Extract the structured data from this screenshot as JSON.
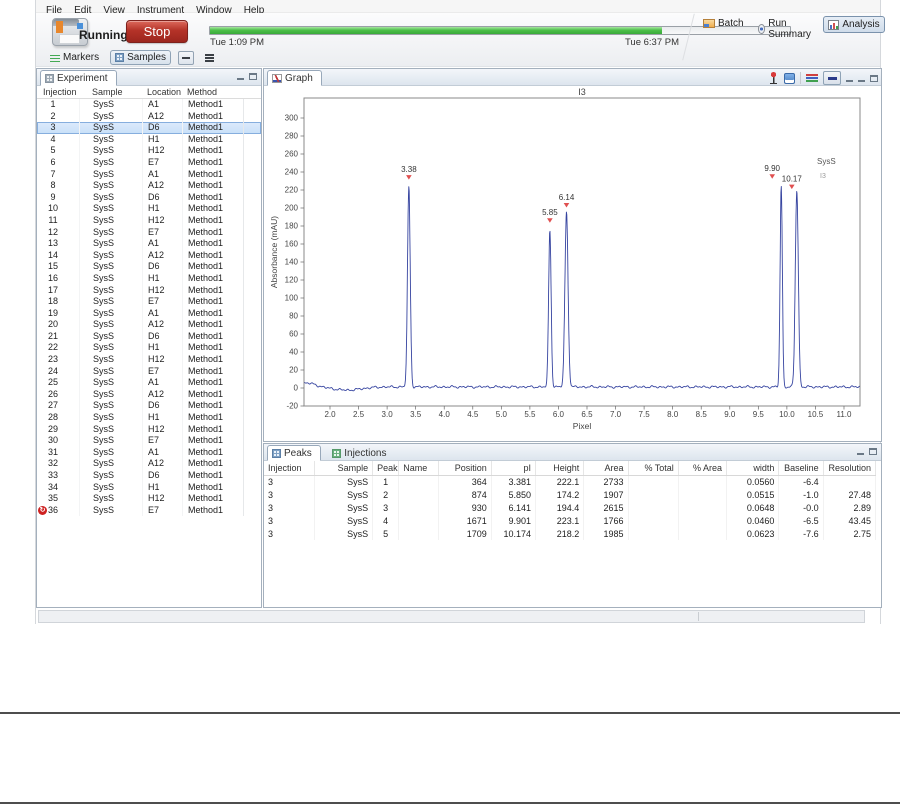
{
  "menu": {
    "items": [
      "File",
      "Edit",
      "View",
      "Instrument",
      "Window",
      "Help"
    ]
  },
  "toolbar": {
    "status": "Running",
    "stop_label": "Stop",
    "progress": {
      "start_label": "Tue 1:09 PM",
      "end_label": "Tue 6:37 PM",
      "fraction": 0.78
    },
    "buttons": [
      {
        "label": "Batch",
        "active": false
      },
      {
        "label": "Run Summary",
        "active": false
      },
      {
        "label": "Analysis",
        "active": true
      }
    ],
    "view_tabs": [
      {
        "label": "Markers",
        "active": false
      },
      {
        "label": "Samples",
        "active": true
      }
    ]
  },
  "experiment": {
    "title": "Experiment",
    "columns": [
      "Injection",
      "Sample",
      "Location",
      "Method"
    ],
    "selected_injection": 3,
    "flagged_injection": 36,
    "rows": [
      [
        1,
        "SysS",
        "A1",
        "Method1"
      ],
      [
        2,
        "SysS",
        "A12",
        "Method1"
      ],
      [
        3,
        "SysS",
        "D6",
        "Method1"
      ],
      [
        4,
        "SysS",
        "H1",
        "Method1"
      ],
      [
        5,
        "SysS",
        "H12",
        "Method1"
      ],
      [
        6,
        "SysS",
        "E7",
        "Method1"
      ],
      [
        7,
        "SysS",
        "A1",
        "Method1"
      ],
      [
        8,
        "SysS",
        "A12",
        "Method1"
      ],
      [
        9,
        "SysS",
        "D6",
        "Method1"
      ],
      [
        10,
        "SysS",
        "H1",
        "Method1"
      ],
      [
        11,
        "SysS",
        "H12",
        "Method1"
      ],
      [
        12,
        "SysS",
        "E7",
        "Method1"
      ],
      [
        13,
        "SysS",
        "A1",
        "Method1"
      ],
      [
        14,
        "SysS",
        "A12",
        "Method1"
      ],
      [
        15,
        "SysS",
        "D6",
        "Method1"
      ],
      [
        16,
        "SysS",
        "H1",
        "Method1"
      ],
      [
        17,
        "SysS",
        "H12",
        "Method1"
      ],
      [
        18,
        "SysS",
        "E7",
        "Method1"
      ],
      [
        19,
        "SysS",
        "A1",
        "Method1"
      ],
      [
        20,
        "SysS",
        "A12",
        "Method1"
      ],
      [
        21,
        "SysS",
        "D6",
        "Method1"
      ],
      [
        22,
        "SysS",
        "H1",
        "Method1"
      ],
      [
        23,
        "SysS",
        "H12",
        "Method1"
      ],
      [
        24,
        "SysS",
        "E7",
        "Method1"
      ],
      [
        25,
        "SysS",
        "A1",
        "Method1"
      ],
      [
        26,
        "SysS",
        "A12",
        "Method1"
      ],
      [
        27,
        "SysS",
        "D6",
        "Method1"
      ],
      [
        28,
        "SysS",
        "H1",
        "Method1"
      ],
      [
        29,
        "SysS",
        "H12",
        "Method1"
      ],
      [
        30,
        "SysS",
        "E7",
        "Method1"
      ],
      [
        31,
        "SysS",
        "A1",
        "Method1"
      ],
      [
        32,
        "SysS",
        "A12",
        "Method1"
      ],
      [
        33,
        "SysS",
        "D6",
        "Method1"
      ],
      [
        34,
        "SysS",
        "H1",
        "Method1"
      ],
      [
        35,
        "SysS",
        "H12",
        "Method1"
      ],
      [
        36,
        "SysS",
        "E7",
        "Method1"
      ]
    ]
  },
  "graph": {
    "tab_label": "Graph"
  },
  "chart_data": {
    "type": "line",
    "title": "I3",
    "xlabel": "Pixel",
    "ylabel": "Absorbance (mAU)",
    "xlim": [
      1.55,
      11.28
    ],
    "ylim": [
      -20,
      322
    ],
    "xticks": [
      2.0,
      2.5,
      3.0,
      3.5,
      4.0,
      4.5,
      5.0,
      5.5,
      6.0,
      6.5,
      7.0,
      7.5,
      8.0,
      8.5,
      9.0,
      9.5,
      10.0,
      10.5,
      11.0
    ],
    "yticks": [
      -20,
      0,
      20,
      40,
      60,
      80,
      100,
      120,
      140,
      160,
      180,
      200,
      220,
      240,
      260,
      280,
      300
    ],
    "legend": {
      "name": "SysS",
      "injection": "I3",
      "position": "top-right"
    },
    "grid": false,
    "baseline": 0,
    "peaks": [
      {
        "pi": 3.381,
        "height": 222.1,
        "width": 0.056,
        "label": "3.38",
        "label_dx": 0,
        "label_dy": 0
      },
      {
        "pi": 5.85,
        "height": 174.2,
        "width": 0.0515,
        "label": "5.85",
        "label_dx": 0,
        "label_dy": 0
      },
      {
        "pi": 6.141,
        "height": 194.4,
        "width": 0.0648,
        "label": "6.14",
        "label_dx": 0,
        "label_dy": 3
      },
      {
        "pi": 9.901,
        "height": 223.1,
        "width": 0.046,
        "label": "9.90",
        "label_dx": -9,
        "label_dy": 0
      },
      {
        "pi": 10.174,
        "height": 218.2,
        "width": 0.0623,
        "label": "10.17",
        "label_dx": -5,
        "label_dy": 6
      }
    ]
  },
  "peaks_panel": {
    "tabs": [
      "Peaks",
      "Injections"
    ],
    "active_tab": "Peaks",
    "columns": [
      "Injection",
      "Sample",
      "Peak",
      "Name",
      "Position",
      "pI",
      "Height",
      "Area",
      "% Total",
      "% Area",
      "width",
      "Baseline",
      "Resolution"
    ],
    "rows": [
      [
        "3",
        "SysS",
        "1",
        "",
        "364",
        "3.381",
        "222.1",
        "2733",
        "",
        "",
        "0.0560",
        "-6.4",
        ""
      ],
      [
        "3",
        "SysS",
        "2",
        "",
        "874",
        "5.850",
        "174.2",
        "1907",
        "",
        "",
        "0.0515",
        "-1.0",
        "27.48"
      ],
      [
        "3",
        "SysS",
        "3",
        "",
        "930",
        "6.141",
        "194.4",
        "2615",
        "",
        "",
        "0.0648",
        "-0.0",
        "2.89"
      ],
      [
        "3",
        "SysS",
        "4",
        "",
        "1671",
        "9.901",
        "223.1",
        "1766",
        "",
        "",
        "0.0460",
        "-6.5",
        "43.45"
      ],
      [
        "3",
        "SysS",
        "5",
        "",
        "1709",
        "10.174",
        "218.2",
        "1985",
        "",
        "",
        "0.0623",
        "-7.6",
        "2.75"
      ]
    ]
  }
}
